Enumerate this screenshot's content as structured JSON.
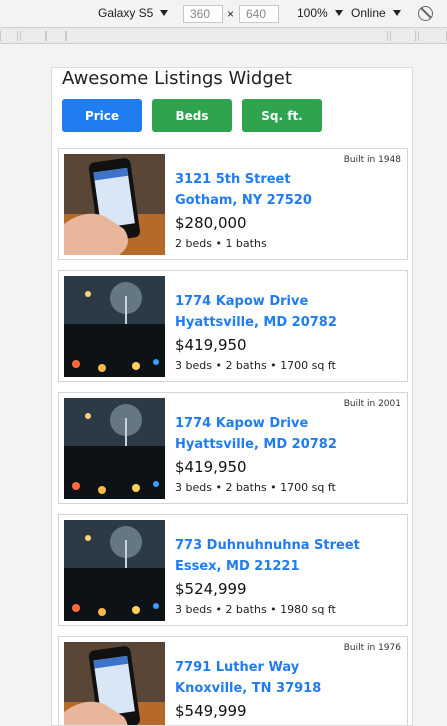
{
  "devtools": {
    "device": "Galaxy S5",
    "width_value": "360",
    "times": "×",
    "height_value": "640",
    "zoom": "100%",
    "network": "Online"
  },
  "widget": {
    "title": "Awesome Listings Widget",
    "buttons": [
      "Price",
      "Beds",
      "Sq. ft."
    ]
  },
  "colors": {
    "primary": "#1f7cf1",
    "success": "#2fa44f",
    "link": "#1f7cf1"
  },
  "listings": [
    {
      "built": "Built in 1948",
      "street": "3121 5th Street",
      "city": "Gotham, NY 27520",
      "price": "$280,000",
      "facts": "2 beds • 1 baths",
      "photo": "phone"
    },
    {
      "built": "",
      "street": "1774 Kapow Drive",
      "city": "Hyattsville, MD 20782",
      "price": "$419,950",
      "facts": "3 beds • 2 baths • 1700 sq ft",
      "photo": "night"
    },
    {
      "built": "Built in 2001",
      "street": "1774 Kapow Drive",
      "city": "Hyattsville, MD 20782",
      "price": "$419,950",
      "facts": "3 beds • 2 baths • 1700 sq ft",
      "photo": "night"
    },
    {
      "built": "",
      "street": "773 Duhnuhnuhna Street",
      "city": "Essex, MD 21221",
      "price": "$524,999",
      "facts": "3 beds • 2 baths • 1980 sq ft",
      "photo": "night"
    },
    {
      "built": "Built in 1976",
      "street": "7791 Luther Way",
      "city": "Knoxville, TN 37918",
      "price": "$549,999",
      "facts": "",
      "photo": "phone"
    }
  ]
}
